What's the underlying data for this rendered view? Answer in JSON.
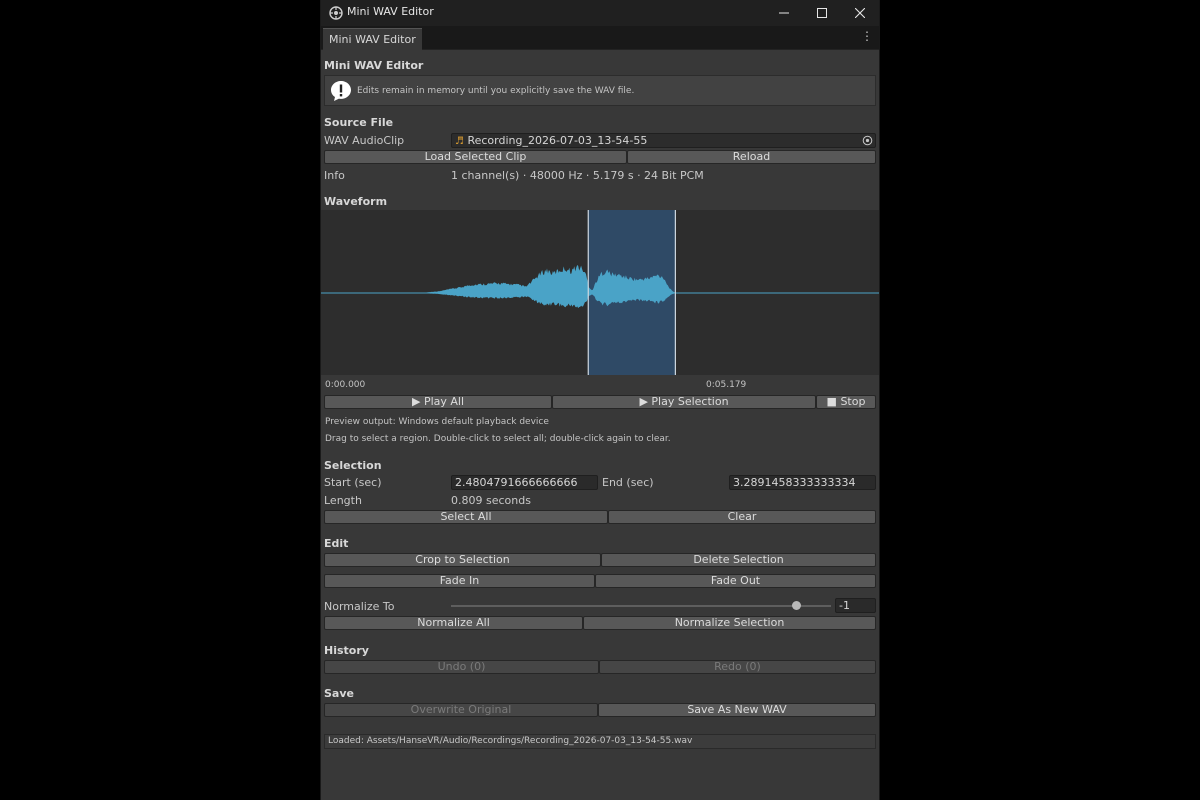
{
  "window": {
    "title": "Mini WAV Editor"
  },
  "tab": {
    "label": "Mini WAV Editor"
  },
  "editor_title": "Mini WAV Editor",
  "help": {
    "text": "Edits remain in memory until you explicitly save the WAV file."
  },
  "source": {
    "header": "Source File",
    "clip_label": "WAV AudioClip",
    "clip_value": "Recording_2026-07-03_13-54-55",
    "load_button": "Load Selected Clip",
    "reload_button": "Reload",
    "info_label": "Info",
    "info_value": "1 channel(s) · 48000 Hz · 5.179 s · 24 Bit PCM"
  },
  "waveform": {
    "header": "Waveform",
    "time_start": "0:00.000",
    "time_end": "0:05.179",
    "duration_sec": 5.179,
    "selection_start_sec": 2.4804791666666666,
    "selection_end_sec": 3.2891458333333334,
    "wave_color": "#4aa3c7",
    "selection_color": "#2f4a66"
  },
  "playback": {
    "play_all": "Play All",
    "play_selection": "Play Selection",
    "stop": "Stop",
    "preview_output": "Preview output: Windows default playback device",
    "hint": "Drag to select a region. Double-click to select all; double-click again to clear."
  },
  "selection": {
    "header": "Selection",
    "start_label": "Start (sec)",
    "start_value": "2.4804791666666666",
    "end_label": "End (sec)",
    "end_value": "3.2891458333333334",
    "length_label": "Length",
    "length_value": "0.809 seconds",
    "select_all": "Select All",
    "clear": "Clear"
  },
  "edit": {
    "header": "Edit",
    "crop": "Crop to Selection",
    "delete": "Delete Selection",
    "fade_in": "Fade In",
    "fade_out": "Fade Out",
    "normalize_label": "Normalize To",
    "normalize_value": "-1",
    "normalize_slider_fraction": 0.91,
    "normalize_all": "Normalize All",
    "normalize_selection": "Normalize Selection"
  },
  "history": {
    "header": "History",
    "undo": "Undo (0)",
    "redo": "Redo (0)"
  },
  "save": {
    "header": "Save",
    "overwrite": "Overwrite Original",
    "save_as": "Save As New WAV"
  },
  "status": {
    "loaded": "Loaded: Assets/HanseVR/Audio/Recordings/Recording_2026-07-03_13-54-55.wav"
  }
}
